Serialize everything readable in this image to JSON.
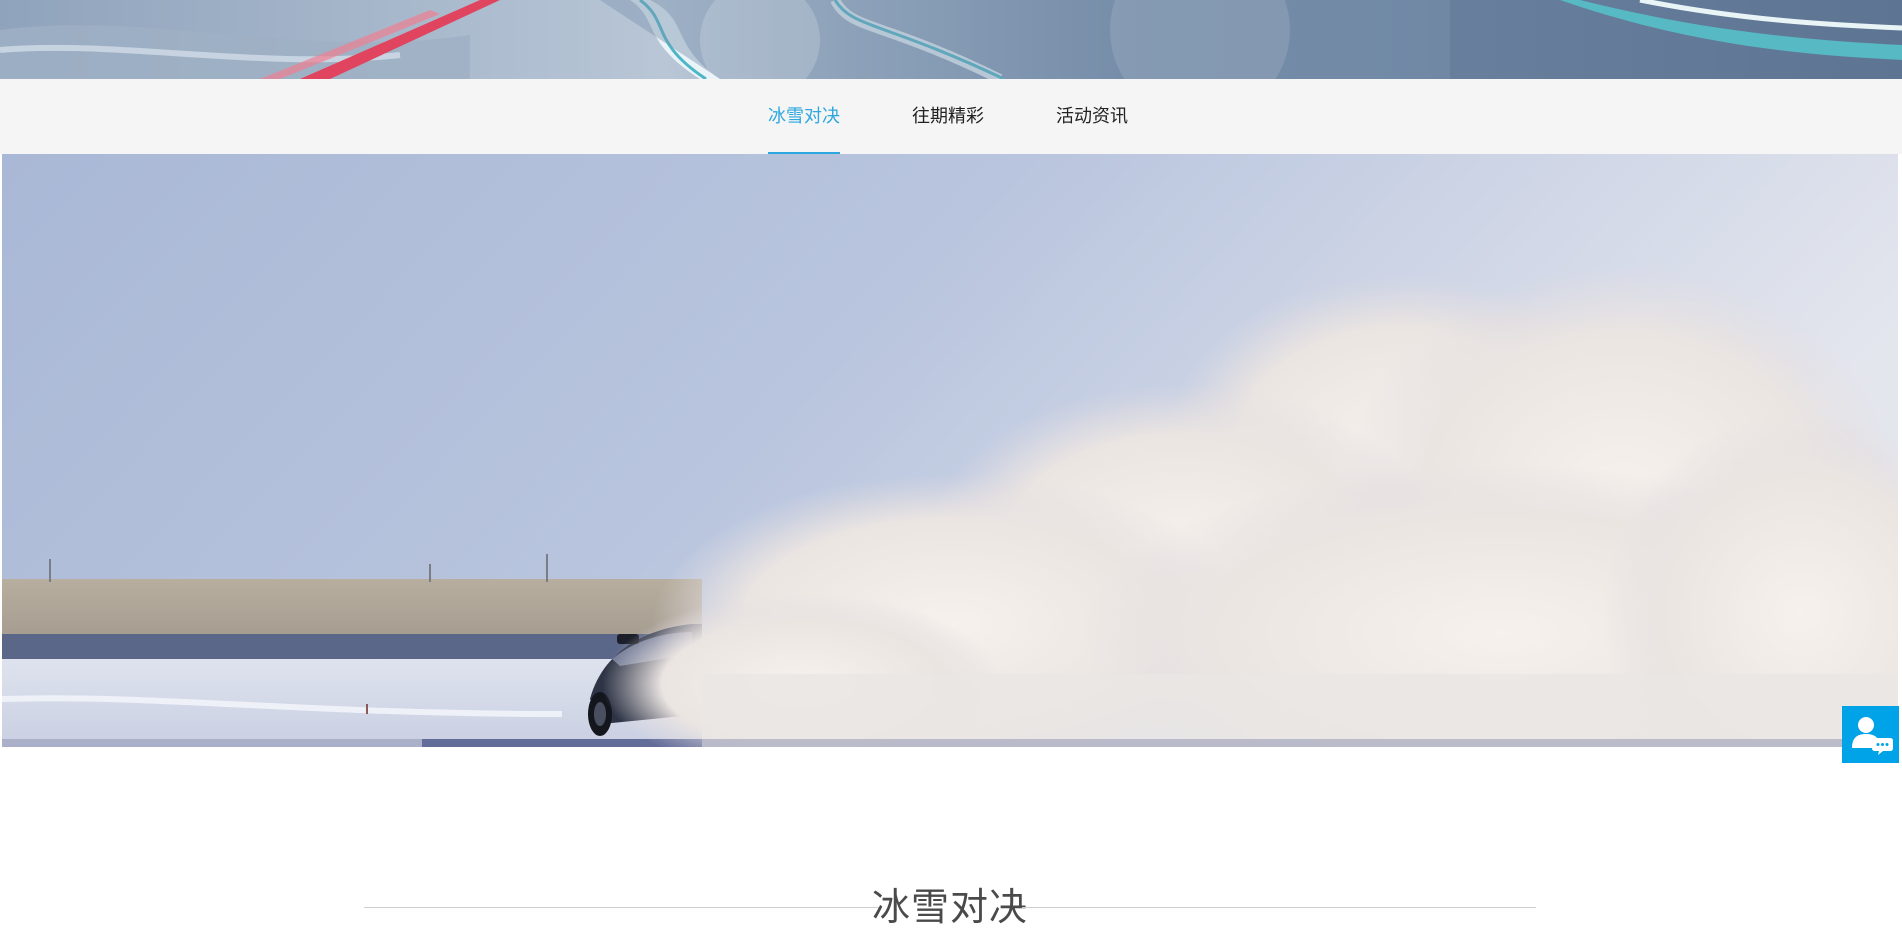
{
  "nav": {
    "tabs": [
      {
        "label": "冰雪对决",
        "active": true
      },
      {
        "label": "往期精彩",
        "active": false
      },
      {
        "label": "活动资讯",
        "active": false
      }
    ]
  },
  "section": {
    "title": "冰雪对决"
  },
  "float_widget": {
    "icon": "customer-service-icon"
  },
  "colors": {
    "accent": "#2da7e0",
    "nav_bg": "#f5f5f5",
    "widget_bg": "#00a3e8"
  }
}
